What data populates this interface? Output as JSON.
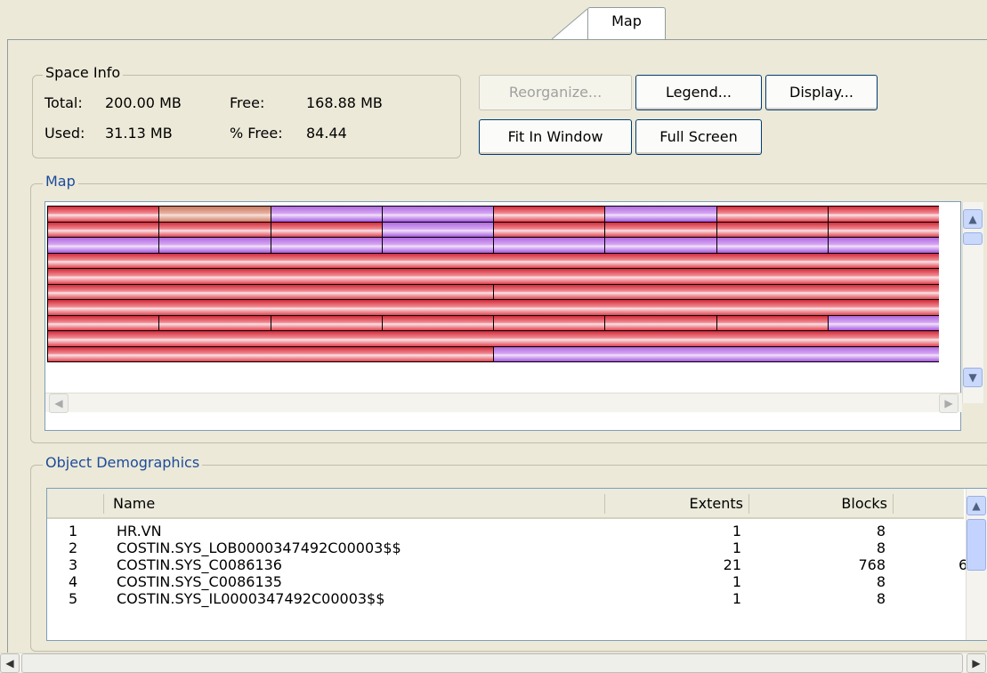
{
  "tab": {
    "label": "Map"
  },
  "space_info": {
    "title": "Space Info",
    "total_label": "Total:",
    "total_value": "200.00 MB",
    "free_label": "Free:",
    "free_value": "168.88 MB",
    "used_label": "Used:",
    "used_value": "31.13 MB",
    "pct_free_label": "% Free:",
    "pct_free_value": "84.44"
  },
  "buttons": {
    "reorganize": "Reorganize...",
    "legend": "Legend...",
    "display": "Display...",
    "fit_in_window": "Fit In Window",
    "full_screen": "Full Screen"
  },
  "map": {
    "title": "Map",
    "colors": {
      "used": "#d22c3b",
      "free": "#b06be0",
      "other": "#c97a62"
    }
  },
  "demographics": {
    "title": "Object Demographics",
    "columns": [
      "",
      "Name",
      "Extents",
      "Blocks"
    ],
    "rows": [
      {
        "num": "1",
        "name": "HR.VN",
        "extents": "1",
        "blocks": "8",
        "extra": ""
      },
      {
        "num": "2",
        "name": "COSTIN.SYS_LOB0000347492C00003$$",
        "extents": "1",
        "blocks": "8",
        "extra": ""
      },
      {
        "num": "3",
        "name": "COSTIN.SYS_C0086136",
        "extents": "21",
        "blocks": "768",
        "extra": "6"
      },
      {
        "num": "4",
        "name": "COSTIN.SYS_C0086135",
        "extents": "1",
        "blocks": "8",
        "extra": ""
      },
      {
        "num": "5",
        "name": "COSTIN.SYS_IL0000347492C00003$$",
        "extents": "1",
        "blocks": "8",
        "extra": ""
      }
    ]
  }
}
